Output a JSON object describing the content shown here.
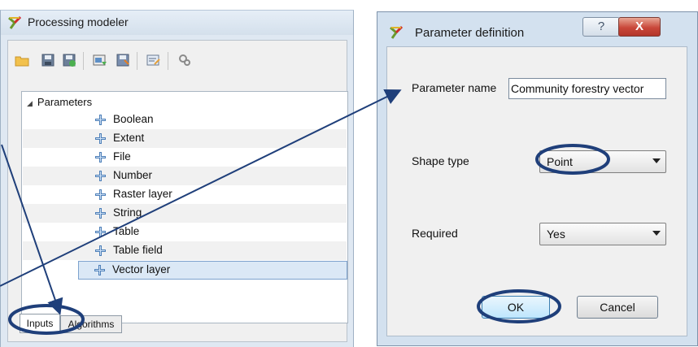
{
  "modeler": {
    "title": "Processing modeler",
    "toolbar_icons": [
      "open-folder-icon",
      "save-icon",
      "save-as-icon",
      "export-image-icon",
      "save-to-collection-icon",
      "edit-help-icon",
      "run-icon"
    ],
    "tree": {
      "root_label": "Parameters",
      "items": [
        {
          "label": "Boolean"
        },
        {
          "label": "Extent"
        },
        {
          "label": "File"
        },
        {
          "label": "Number"
        },
        {
          "label": "Raster layer"
        },
        {
          "label": "String"
        },
        {
          "label": "Table"
        },
        {
          "label": "Table field"
        },
        {
          "label": "Vector layer",
          "selected": true
        }
      ]
    },
    "tabs": [
      {
        "label": "Inputs",
        "active": true
      },
      {
        "label": "Algorithms",
        "active": false
      }
    ]
  },
  "dialog": {
    "title": "Parameter definition",
    "help_label": "?",
    "close_label": "X",
    "parameter_name_label": "Parameter name",
    "parameter_name_value": "Community forestry vector",
    "shape_type_label": "Shape type",
    "shape_type_value": "Point",
    "required_label": "Required",
    "required_value": "Yes",
    "ok_label": "OK",
    "cancel_label": "Cancel"
  },
  "annotation": {
    "color": "#1f3f7a"
  }
}
